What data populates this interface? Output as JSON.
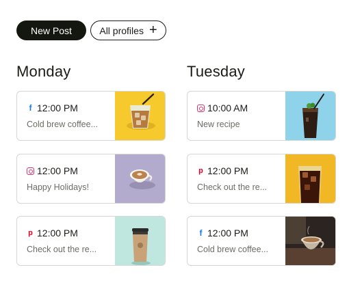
{
  "toolbar": {
    "new_post_label": "New Post",
    "all_profiles_label": "All profiles",
    "plus_glyph": "+"
  },
  "days": [
    {
      "name": "Monday",
      "posts": [
        {
          "network": "facebook",
          "icon_glyph": "f",
          "time": "12:00 PM",
          "caption": "Cold brew coffee...",
          "image": "iced-coffee-glass-on-yellow"
        },
        {
          "network": "instagram",
          "icon_glyph": "",
          "time": "12:00 PM",
          "caption": "Happy Holidays!",
          "image": "latte-art-cup-on-lilac"
        },
        {
          "network": "pinterest",
          "icon_glyph": "p",
          "time": "12:00 PM",
          "caption": "Check out the re...",
          "image": "takeaway-cup-on-mint"
        }
      ]
    },
    {
      "name": "Tuesday",
      "posts": [
        {
          "network": "instagram",
          "icon_glyph": "",
          "time": "10:00 AM",
          "caption": "New recipe",
          "image": "iced-coffee-with-mint-on-blue"
        },
        {
          "network": "pinterest",
          "icon_glyph": "p",
          "time": "12:00 PM",
          "caption": "Check out the re...",
          "image": "iced-cola-glass-on-yellow"
        },
        {
          "network": "facebook",
          "icon_glyph": "f",
          "time": "12:00 PM",
          "caption": "Cold brew coffee...",
          "image": "latte-cup-on-wooden-table"
        }
      ]
    }
  ],
  "colors": {
    "primary_button": "#14170f",
    "facebook": "#1877f2",
    "instagram": "#e1306c",
    "pinterest": "#e60023",
    "card_border": "#d6d6d2"
  }
}
